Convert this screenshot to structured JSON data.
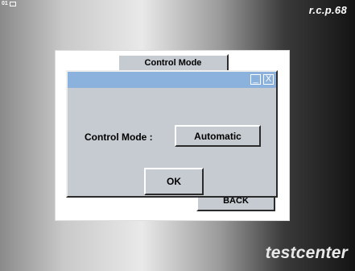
{
  "top_bar": {
    "widget_number": "01",
    "brand": "r.c.p.68"
  },
  "background_screen": {
    "control_mode_button": "Control Mode",
    "back_button": "BACK"
  },
  "dialog": {
    "title": "",
    "control_mode_label": "Control Mode :",
    "control_mode_value": "Automatic",
    "ok_button": "OK",
    "minimize_glyph": "_",
    "close_glyph": "X"
  },
  "footer": {
    "brand": "testcenter"
  },
  "colors": {
    "dialog_titlebar": "#8ab2dc",
    "button_face": "#c5cbd0"
  }
}
